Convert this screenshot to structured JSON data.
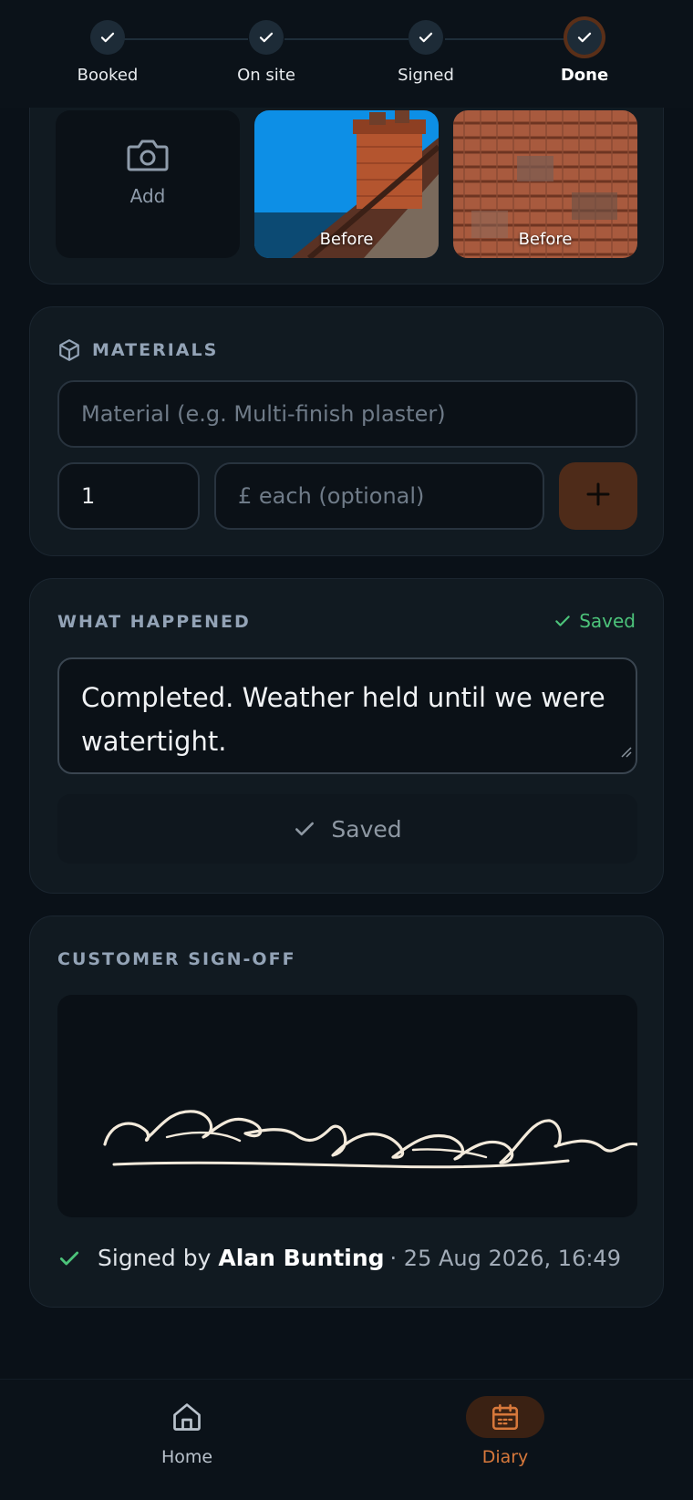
{
  "stepper": {
    "steps": [
      {
        "label": "Booked",
        "done": true
      },
      {
        "label": "On site",
        "done": true
      },
      {
        "label": "Signed",
        "done": true
      },
      {
        "label": "Done",
        "done": true,
        "active": true
      }
    ]
  },
  "photos": {
    "add_label": "Add",
    "items": [
      {
        "label": "Before"
      },
      {
        "label": "Before"
      }
    ]
  },
  "materials": {
    "title": "MATERIALS",
    "material_placeholder": "Material (e.g. Multi-finish plaster)",
    "quantity_value": "1",
    "price_placeholder": "£ each (optional)"
  },
  "what_happened": {
    "title": "WHAT HAPPENED",
    "saved_badge": "Saved",
    "notes_text": "Completed. Weather held until we were watertight.",
    "saved_button_label": "Saved"
  },
  "signoff": {
    "title": "CUSTOMER SIGN-OFF",
    "signed_prefix": "Signed by",
    "signer_name": "Alan Bunting",
    "signed_when": "· 25 Aug 2026, 16:49"
  },
  "nav": {
    "items": [
      {
        "label": "Home",
        "icon": "home-icon",
        "active": false
      },
      {
        "label": "Diary",
        "icon": "calendar-icon",
        "active": true
      }
    ]
  },
  "colors": {
    "accent": "#d7783b",
    "success": "#4cc37a",
    "background": "#0a1118",
    "card": "#111a21"
  }
}
